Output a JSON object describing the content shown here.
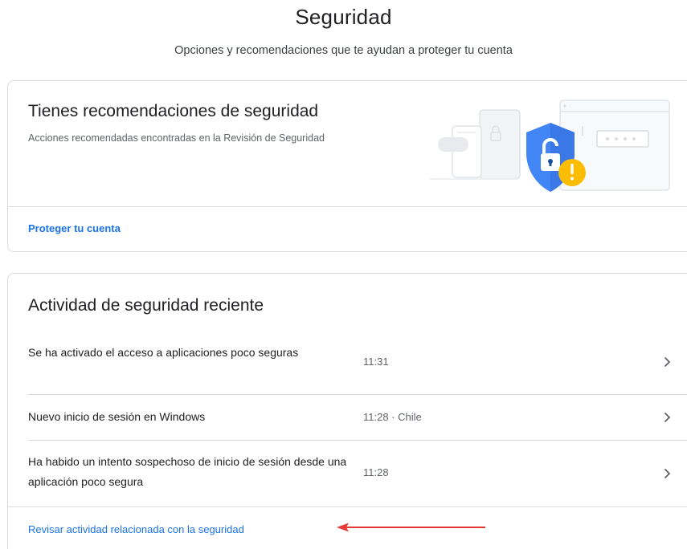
{
  "header": {
    "title": "Seguridad",
    "subtitle": "Opciones y recomendaciones que te ayudan a proteger tu cuenta"
  },
  "recommendations_card": {
    "title": "Tienes recomendaciones de seguridad",
    "description": "Acciones recomendadas encontradas en la Revisión de Seguridad",
    "link_label": "Proteger tu cuenta",
    "illustration_icons": [
      "devices-illustration",
      "shield-lock-icon",
      "warning-icon",
      "password-field-icon"
    ],
    "colors": {
      "shield": "#4285f4",
      "warning": "#fbbc04",
      "link": "#1a73e8"
    }
  },
  "activity_card": {
    "title": "Actividad de seguridad reciente",
    "items": [
      {
        "title": "Se ha activado el acceso a aplicaciones poco seguras",
        "time": "11:31"
      },
      {
        "title": "Nuevo inicio de sesión en Windows",
        "time": "11:28 · Chile"
      },
      {
        "title": "Ha habido un intento sospechoso de inicio de sesión desde una aplicación poco segura",
        "time": "11:28"
      }
    ],
    "link_label": "Revisar actividad relacionada con la seguridad",
    "annotation_arrow_color": "#e53935"
  }
}
